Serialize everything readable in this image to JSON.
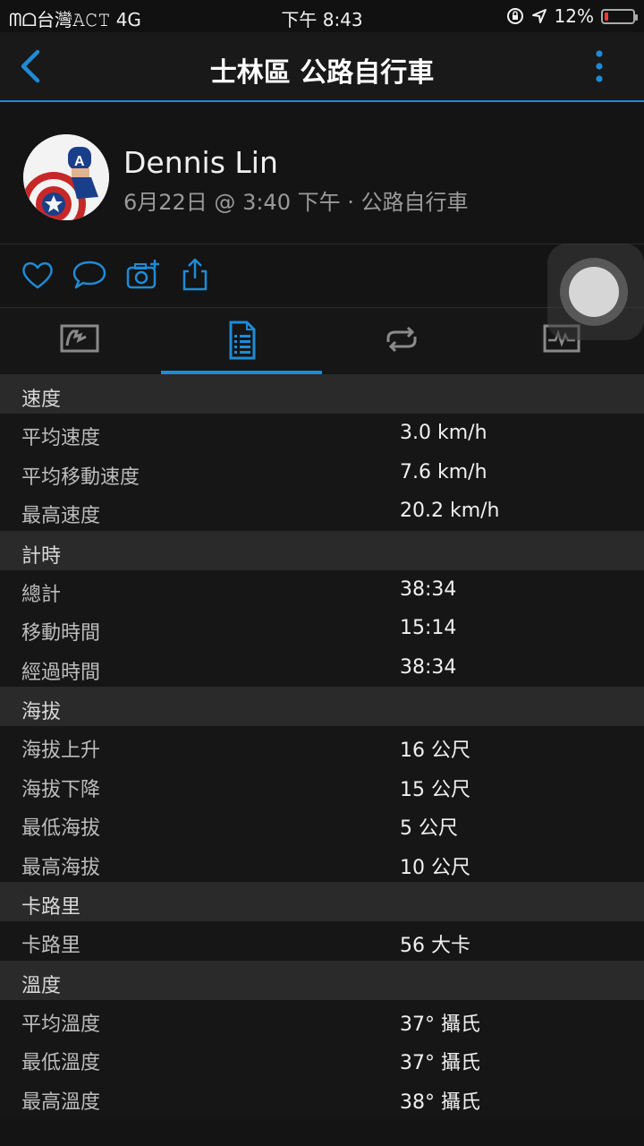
{
  "status": {
    "left": "ᗰᗝ台灣𝙰𝙲𝚃 4G",
    "time": "下午 8:43",
    "battery": "12%"
  },
  "nav": {
    "title": "士林區 公路自行車"
  },
  "profile": {
    "name": "Dennis Lin",
    "subtitle": "6月22日 @ 3:40 下午 · 公路自行車"
  },
  "actions": [
    "heart-icon",
    "comment-icon",
    "camera-add-icon",
    "share-icon"
  ],
  "tabs": [
    "map-tab",
    "stats-tab",
    "laps-tab",
    "charts-tab"
  ],
  "sections": [
    {
      "title": "速度",
      "rows": [
        {
          "label": "平均速度",
          "value": "3.0 km/h"
        },
        {
          "label": "平均移動速度",
          "value": "7.6 km/h"
        },
        {
          "label": "最高速度",
          "value": "20.2 km/h"
        }
      ]
    },
    {
      "title": "計時",
      "rows": [
        {
          "label": "總計",
          "value": "38:34"
        },
        {
          "label": "移動時間",
          "value": "15:14"
        },
        {
          "label": "經過時間",
          "value": "38:34"
        }
      ]
    },
    {
      "title": "海拔",
      "rows": [
        {
          "label": "海拔上升",
          "value": "16 公尺"
        },
        {
          "label": "海拔下降",
          "value": "15 公尺"
        },
        {
          "label": "最低海拔",
          "value": "5 公尺"
        },
        {
          "label": "最高海拔",
          "value": "10 公尺"
        }
      ]
    },
    {
      "title": "卡路里",
      "rows": [
        {
          "label": "卡路里",
          "value": "56 大卡"
        }
      ]
    },
    {
      "title": "溫度",
      "rows": [
        {
          "label": "平均溫度",
          "value": "37° 攝氏"
        },
        {
          "label": "最低溫度",
          "value": "37° 攝氏"
        },
        {
          "label": "最高溫度",
          "value": "38° 攝氏"
        }
      ]
    }
  ],
  "colors": {
    "accent": "#1f8bd6",
    "battery_low": "#ff3b30"
  }
}
